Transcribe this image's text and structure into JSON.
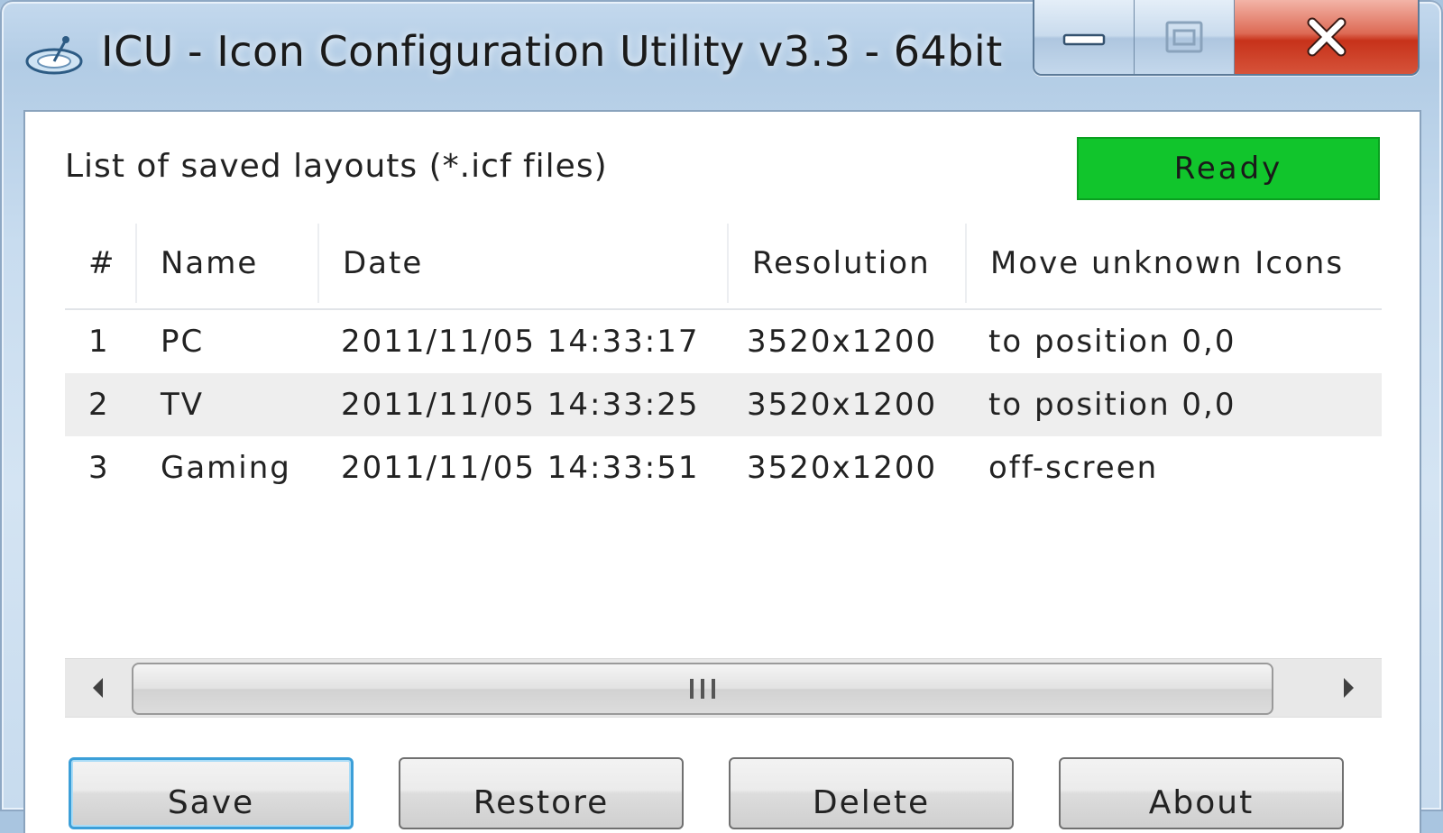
{
  "window": {
    "title": "ICU - Icon Configuration Utility v3.3 - 64bit",
    "app_icon": "satellite-dish-icon",
    "caption_buttons": [
      {
        "name": "minimize",
        "icon": "minimize-icon"
      },
      {
        "name": "maximize",
        "icon": "maximize-icon"
      },
      {
        "name": "close",
        "icon": "close-icon"
      }
    ]
  },
  "main": {
    "list_label": "List of saved layouts (*.icf files)",
    "status": {
      "text": "Ready",
      "color": "#11c52c"
    },
    "table": {
      "columns": [
        "#",
        "Name",
        "Date",
        "Resolution",
        "Move unknown Icons"
      ],
      "rows": [
        [
          "1",
          "PC",
          "2011/11/05 14:33:17",
          "3520x1200",
          "to position 0,0"
        ],
        [
          "2",
          "TV",
          "2011/11/05 14:33:25",
          "3520x1200",
          "to position 0,0"
        ],
        [
          "3",
          "Gaming",
          "2011/11/05 14:33:51",
          "3520x1200",
          "off-screen"
        ]
      ]
    },
    "scrollbar": {
      "left_arrow": "arrow-left-icon",
      "right_arrow": "arrow-right-icon",
      "grip": "grip-icon",
      "thumb_fraction": 0.86
    },
    "buttons": {
      "save": "Save",
      "restore": "Restore",
      "delete": "Delete",
      "about": "About"
    }
  }
}
